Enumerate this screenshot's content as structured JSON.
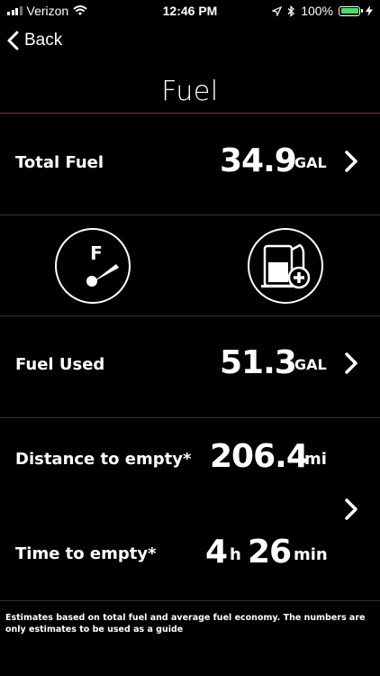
{
  "status_bar": {
    "carrier": "Verizon",
    "time": "12:46 PM",
    "battery": "100%",
    "battery_color": "#4cd964"
  },
  "nav": {
    "back_label": "Back",
    "title": "Fuel"
  },
  "total_fuel": {
    "label": "Total Fuel",
    "value": "34.9",
    "unit": "GAL"
  },
  "actions": {
    "gauge_icon_letter": "F"
  },
  "fuel_used": {
    "label": "Fuel Used",
    "value": "51.3",
    "unit": "GAL"
  },
  "distance_to_empty": {
    "label": "Distance to empty*",
    "value": "206.4",
    "unit": "mi"
  },
  "time_to_empty": {
    "label": "Time to empty*",
    "hours": "4",
    "hours_unit": "h",
    "minutes": "26",
    "minutes_unit": "min"
  },
  "footnote": "Estimates based on total fuel and average fuel economy. The numbers are only estimates to be used as a guide",
  "colors": {
    "background": "#000000",
    "accent_line": "#7a3b2d",
    "divider": "#333333"
  }
}
